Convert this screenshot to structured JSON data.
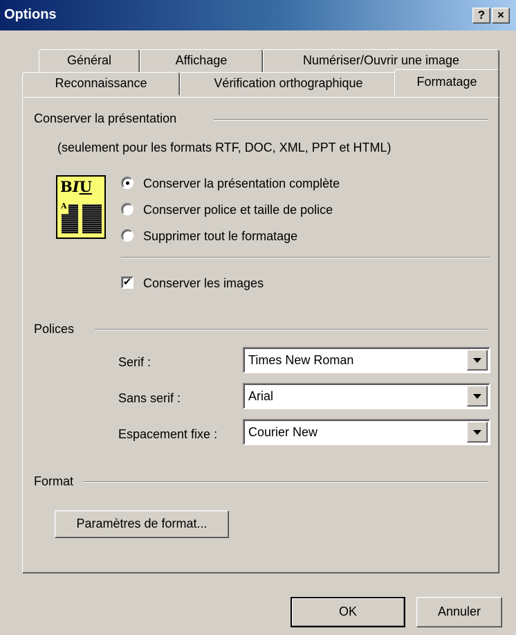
{
  "window": {
    "title": "Options",
    "help_glyph": "?",
    "close_glyph": "×"
  },
  "tabs": {
    "row_back": [
      "Général",
      "Affichage",
      "Numériser/Ouvrir une image"
    ],
    "row_front": [
      "Reconnaissance",
      "Vérification orthographique",
      "Formatage"
    ],
    "active": "Formatage"
  },
  "layout_section": {
    "title": "Conserver la présentation",
    "note": "(seulement pour les formats RTF, DOC, XML, PPT et HTML)",
    "icon": {
      "name": "formatting-icon",
      "letters": [
        "B",
        "I",
        "U"
      ],
      "small_letter": "A"
    },
    "radios": [
      {
        "label": "Conserver la présentation complète",
        "checked": true
      },
      {
        "label": "Conserver police et taille de police",
        "checked": false
      },
      {
        "label": "Supprimer tout le formatage",
        "checked": false
      }
    ],
    "keep_images": {
      "label": "Conserver les images",
      "checked": true,
      "mark": "✔"
    }
  },
  "fonts_section": {
    "title": "Polices",
    "rows": [
      {
        "label": "Serif :",
        "value": "Times New Roman"
      },
      {
        "label": "Sans serif :",
        "value": "Arial"
      },
      {
        "label": "Espacement fixe :",
        "value": "Courier New"
      }
    ]
  },
  "format_section": {
    "title": "Format",
    "button_label": "Paramètres de format..."
  },
  "footer": {
    "ok_label": "OK",
    "cancel_label": "Annuler"
  }
}
